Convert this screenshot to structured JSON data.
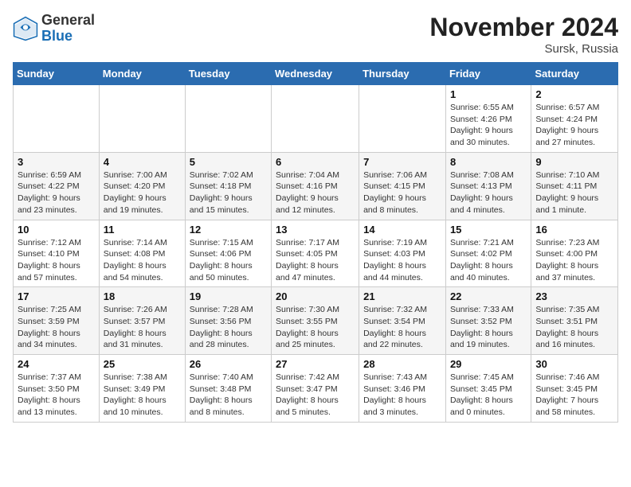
{
  "header": {
    "logo_general": "General",
    "logo_blue": "Blue",
    "month_title": "November 2024",
    "location": "Sursk, Russia"
  },
  "weekdays": [
    "Sunday",
    "Monday",
    "Tuesday",
    "Wednesday",
    "Thursday",
    "Friday",
    "Saturday"
  ],
  "weeks": [
    [
      {
        "day": "",
        "info": ""
      },
      {
        "day": "",
        "info": ""
      },
      {
        "day": "",
        "info": ""
      },
      {
        "day": "",
        "info": ""
      },
      {
        "day": "",
        "info": ""
      },
      {
        "day": "1",
        "info": "Sunrise: 6:55 AM\nSunset: 4:26 PM\nDaylight: 9 hours\nand 30 minutes."
      },
      {
        "day": "2",
        "info": "Sunrise: 6:57 AM\nSunset: 4:24 PM\nDaylight: 9 hours\nand 27 minutes."
      }
    ],
    [
      {
        "day": "3",
        "info": "Sunrise: 6:59 AM\nSunset: 4:22 PM\nDaylight: 9 hours\nand 23 minutes."
      },
      {
        "day": "4",
        "info": "Sunrise: 7:00 AM\nSunset: 4:20 PM\nDaylight: 9 hours\nand 19 minutes."
      },
      {
        "day": "5",
        "info": "Sunrise: 7:02 AM\nSunset: 4:18 PM\nDaylight: 9 hours\nand 15 minutes."
      },
      {
        "day": "6",
        "info": "Sunrise: 7:04 AM\nSunset: 4:16 PM\nDaylight: 9 hours\nand 12 minutes."
      },
      {
        "day": "7",
        "info": "Sunrise: 7:06 AM\nSunset: 4:15 PM\nDaylight: 9 hours\nand 8 minutes."
      },
      {
        "day": "8",
        "info": "Sunrise: 7:08 AM\nSunset: 4:13 PM\nDaylight: 9 hours\nand 4 minutes."
      },
      {
        "day": "9",
        "info": "Sunrise: 7:10 AM\nSunset: 4:11 PM\nDaylight: 9 hours\nand 1 minute."
      }
    ],
    [
      {
        "day": "10",
        "info": "Sunrise: 7:12 AM\nSunset: 4:10 PM\nDaylight: 8 hours\nand 57 minutes."
      },
      {
        "day": "11",
        "info": "Sunrise: 7:14 AM\nSunset: 4:08 PM\nDaylight: 8 hours\nand 54 minutes."
      },
      {
        "day": "12",
        "info": "Sunrise: 7:15 AM\nSunset: 4:06 PM\nDaylight: 8 hours\nand 50 minutes."
      },
      {
        "day": "13",
        "info": "Sunrise: 7:17 AM\nSunset: 4:05 PM\nDaylight: 8 hours\nand 47 minutes."
      },
      {
        "day": "14",
        "info": "Sunrise: 7:19 AM\nSunset: 4:03 PM\nDaylight: 8 hours\nand 44 minutes."
      },
      {
        "day": "15",
        "info": "Sunrise: 7:21 AM\nSunset: 4:02 PM\nDaylight: 8 hours\nand 40 minutes."
      },
      {
        "day": "16",
        "info": "Sunrise: 7:23 AM\nSunset: 4:00 PM\nDaylight: 8 hours\nand 37 minutes."
      }
    ],
    [
      {
        "day": "17",
        "info": "Sunrise: 7:25 AM\nSunset: 3:59 PM\nDaylight: 8 hours\nand 34 minutes."
      },
      {
        "day": "18",
        "info": "Sunrise: 7:26 AM\nSunset: 3:57 PM\nDaylight: 8 hours\nand 31 minutes."
      },
      {
        "day": "19",
        "info": "Sunrise: 7:28 AM\nSunset: 3:56 PM\nDaylight: 8 hours\nand 28 minutes."
      },
      {
        "day": "20",
        "info": "Sunrise: 7:30 AM\nSunset: 3:55 PM\nDaylight: 8 hours\nand 25 minutes."
      },
      {
        "day": "21",
        "info": "Sunrise: 7:32 AM\nSunset: 3:54 PM\nDaylight: 8 hours\nand 22 minutes."
      },
      {
        "day": "22",
        "info": "Sunrise: 7:33 AM\nSunset: 3:52 PM\nDaylight: 8 hours\nand 19 minutes."
      },
      {
        "day": "23",
        "info": "Sunrise: 7:35 AM\nSunset: 3:51 PM\nDaylight: 8 hours\nand 16 minutes."
      }
    ],
    [
      {
        "day": "24",
        "info": "Sunrise: 7:37 AM\nSunset: 3:50 PM\nDaylight: 8 hours\nand 13 minutes."
      },
      {
        "day": "25",
        "info": "Sunrise: 7:38 AM\nSunset: 3:49 PM\nDaylight: 8 hours\nand 10 minutes."
      },
      {
        "day": "26",
        "info": "Sunrise: 7:40 AM\nSunset: 3:48 PM\nDaylight: 8 hours\nand 8 minutes."
      },
      {
        "day": "27",
        "info": "Sunrise: 7:42 AM\nSunset: 3:47 PM\nDaylight: 8 hours\nand 5 minutes."
      },
      {
        "day": "28",
        "info": "Sunrise: 7:43 AM\nSunset: 3:46 PM\nDaylight: 8 hours\nand 3 minutes."
      },
      {
        "day": "29",
        "info": "Sunrise: 7:45 AM\nSunset: 3:45 PM\nDaylight: 8 hours\nand 0 minutes."
      },
      {
        "day": "30",
        "info": "Sunrise: 7:46 AM\nSunset: 3:45 PM\nDaylight: 7 hours\nand 58 minutes."
      }
    ]
  ]
}
